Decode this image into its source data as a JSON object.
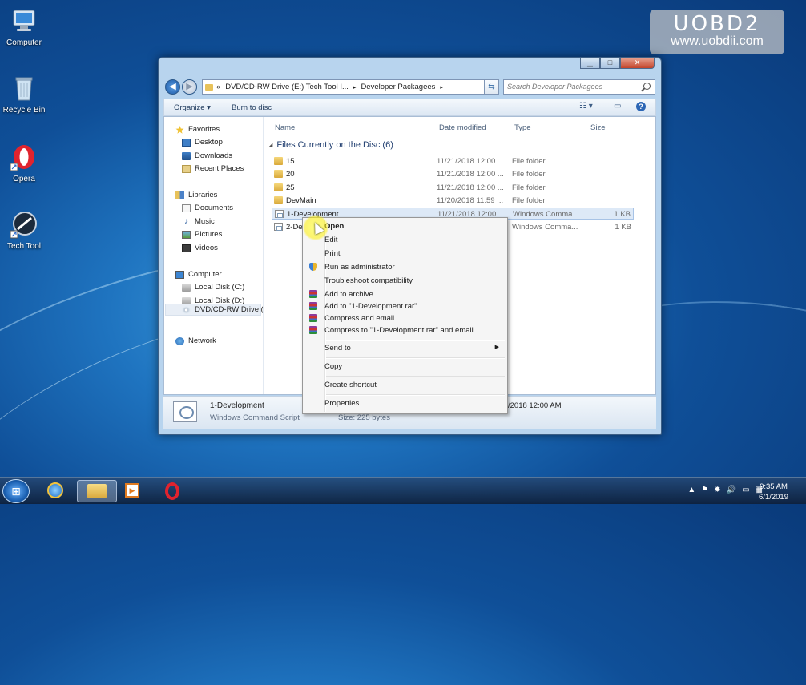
{
  "desktop": {
    "icons": [
      {
        "label": "Computer"
      },
      {
        "label": "Recycle Bin"
      },
      {
        "label": "Opera"
      },
      {
        "label": "Tech Tool"
      }
    ],
    "watermark": {
      "title": "UOBD2",
      "url": "www.uobdii.com"
    }
  },
  "window": {
    "address": {
      "chevrons": "«",
      "crumbs": [
        "DVD/CD-RW Drive (E:) Tech Tool I...",
        "Developer Packagees"
      ],
      "separator": "▸"
    },
    "search_placeholder": "Search Developer Packagees",
    "toolbar": {
      "organize": "Organize ▾",
      "burn": "Burn to disc"
    },
    "nav": {
      "favorites": {
        "label": "Favorites",
        "items": [
          "Desktop",
          "Downloads",
          "Recent Places"
        ]
      },
      "libraries": {
        "label": "Libraries",
        "items": [
          "Documents",
          "Music",
          "Pictures",
          "Videos"
        ]
      },
      "computer": {
        "label": "Computer",
        "items": [
          "Local Disk (C:)",
          "Local Disk (D:)",
          "DVD/CD-RW Drive (I"
        ]
      },
      "network": {
        "label": "Network"
      }
    },
    "columns": {
      "name": "Name",
      "date": "Date modified",
      "type": "Type",
      "size": "Size"
    },
    "group_header": "Files Currently on the Disc (6)",
    "files": [
      {
        "name": "15",
        "date": "11/21/2018 12:00 ...",
        "type": "File folder",
        "size": "",
        "kind": "folder"
      },
      {
        "name": "20",
        "date": "11/21/2018 12:00 ...",
        "type": "File folder",
        "size": "",
        "kind": "folder"
      },
      {
        "name": "25",
        "date": "11/21/2018 12:00 ...",
        "type": "File folder",
        "size": "",
        "kind": "folder"
      },
      {
        "name": "DevMain",
        "date": "11/20/2018 11:59 ...",
        "type": "File folder",
        "size": "",
        "kind": "folder"
      },
      {
        "name": "1-Development",
        "date": "11/21/2018 12:00 ...",
        "type": "Windows Comma...",
        "size": "1 KB",
        "kind": "script",
        "selected": true
      },
      {
        "name": "2-De",
        "date": "",
        "type": "Windows Comma...",
        "size": "1 KB",
        "kind": "script"
      }
    ],
    "details": {
      "name": "1-Development",
      "type": "Windows Command Script",
      "date_modified": "/2018 12:00 AM",
      "size": "Size: 225 bytes"
    }
  },
  "context_menu": {
    "open": "Open",
    "edit": "Edit",
    "print": "Print",
    "run_as_admin": "Run as administrator",
    "troubleshoot": "Troubleshoot compatibility",
    "add_archive": "Add to archive...",
    "add_rar": "Add to \"1-Development.rar\"",
    "compress_email": "Compress and email...",
    "compress_rar_email": "Compress to \"1-Development.rar\" and email",
    "send_to": "Send to",
    "copy": "Copy",
    "create_shortcut": "Create shortcut",
    "properties": "Properties"
  },
  "taskbar": {
    "time": "9:35 AM",
    "date": "6/1/2019"
  }
}
